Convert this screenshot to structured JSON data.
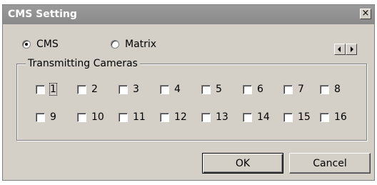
{
  "window": {
    "title": "CMS Setting",
    "close_glyph": "×"
  },
  "mode": {
    "options": [
      {
        "label": "CMS",
        "selected": true
      },
      {
        "label": "Matrix",
        "selected": false
      }
    ]
  },
  "group": {
    "label": "Transmitting Cameras",
    "cameras": [
      "1",
      "2",
      "3",
      "4",
      "5",
      "6",
      "7",
      "8",
      "9",
      "10",
      "11",
      "12",
      "13",
      "14",
      "15",
      "16"
    ]
  },
  "buttons": {
    "ok": "OK",
    "cancel": "Cancel"
  },
  "icons": {
    "close": "close-icon",
    "prev": "arrow-left-icon",
    "next": "arrow-right-icon"
  },
  "colors": {
    "face": "#d4d0c8",
    "titlebar": "#8a8a8a",
    "title_text": "#ffffff"
  }
}
